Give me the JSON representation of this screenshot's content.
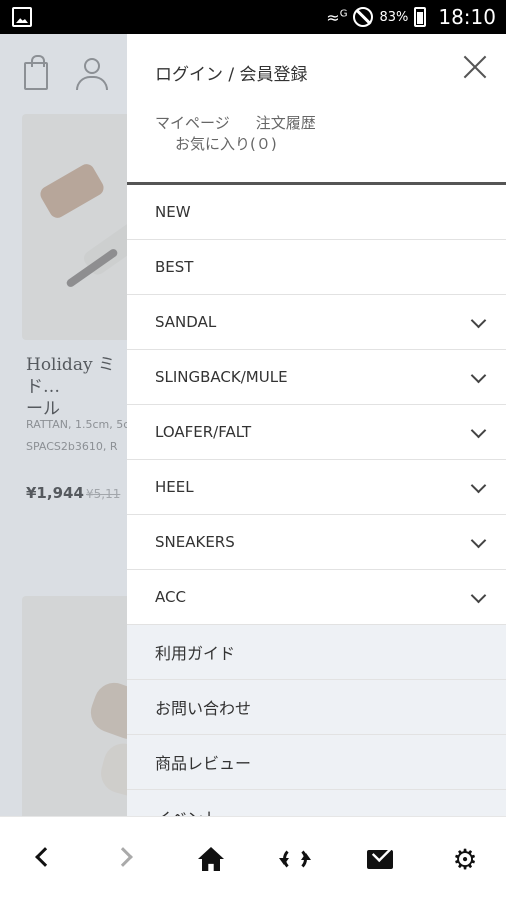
{
  "status_bar": {
    "network": "G",
    "battery": "83%",
    "time": "18:10"
  },
  "background_page": {
    "product_title": "Holiday ミド…\nール",
    "product_meta": "RATTAN, 1.5cm, 5c\nSPACS2b3610, R",
    "price": "¥1,944",
    "old_price": "¥5,11"
  },
  "drawer": {
    "login_label": "ログイン / 会員登録",
    "mypage_label": "マイページ",
    "orders_label": "注文履歴",
    "favorites_label": "お気に入り(０)",
    "menu_items": [
      {
        "label": "NEW",
        "has_chevron": false
      },
      {
        "label": "BEST",
        "has_chevron": false
      },
      {
        "label": "SANDAL",
        "has_chevron": true
      },
      {
        "label": "SLINGBACK/MULE",
        "has_chevron": true
      },
      {
        "label": "LOAFER/FALT",
        "has_chevron": true
      },
      {
        "label": "HEEL",
        "has_chevron": true
      },
      {
        "label": "SNEAKERS",
        "has_chevron": true
      },
      {
        "label": "ACC",
        "has_chevron": true
      }
    ],
    "info_items": [
      {
        "label": "利用ガイド"
      },
      {
        "label": "お問い合わせ"
      },
      {
        "label": "商品レビュー"
      },
      {
        "label": "イベント"
      }
    ]
  },
  "bottom_nav": {
    "icons": [
      "back-icon",
      "forward-icon",
      "home-icon",
      "reload-icon",
      "mail-icon",
      "settings-icon"
    ]
  }
}
